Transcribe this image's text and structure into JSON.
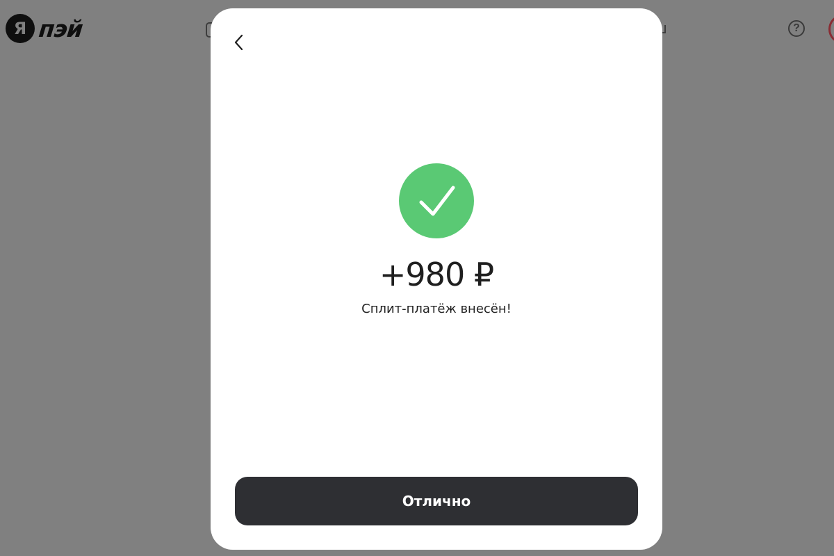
{
  "header": {
    "logo_mark": "Я",
    "logo_text": "пэй",
    "help_symbol": "?",
    "icons": [
      "help-icon",
      "avatar"
    ]
  },
  "dialog": {
    "back_icon": "chevron-left-icon",
    "status_icon": "check-circle-icon",
    "amount": "+980 ₽",
    "message": "Сплит-платёж внесён!",
    "confirm_label": "Отлично"
  },
  "colors": {
    "overlay": "#808080",
    "success": "#5ac974",
    "button": "#2e2f33",
    "modal": "#ffffff"
  }
}
